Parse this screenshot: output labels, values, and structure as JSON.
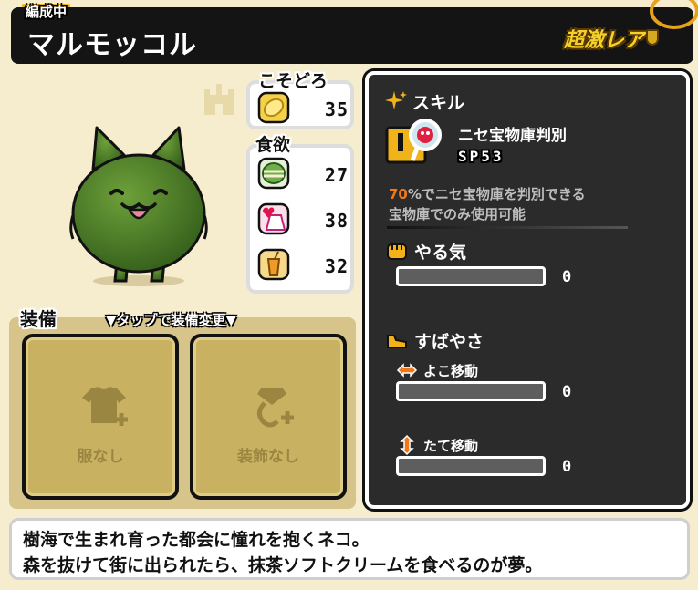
{
  "header": {
    "status_tag": "編成中",
    "name": "マルモッコル",
    "rarity": "超激レア"
  },
  "stats": {
    "sneak": {
      "title": "こそどろ",
      "value": "35",
      "icon": "gold-coin-icon"
    },
    "appetite": {
      "title": "食欲",
      "items": [
        {
          "icon": "matcha-cake-icon",
          "value": "27"
        },
        {
          "icon": "heart-dessert-icon",
          "value": "38"
        },
        {
          "icon": "drink-cup-icon",
          "value": "32"
        }
      ]
    }
  },
  "equip": {
    "title": "装備",
    "hint": "▼タップで装備変更▼",
    "slots": [
      {
        "label": "服なし",
        "icon": "shirt-plus-icon"
      },
      {
        "label": "装飾なし",
        "icon": "jewel-plus-icon"
      }
    ]
  },
  "skill": {
    "title": "スキル",
    "name": "ニセ宝物庫判別",
    "sp": "SP53",
    "desc_pct": "70",
    "desc_line1": "%でニセ宝物庫を判別できる",
    "desc_line2": "宝物庫でのみ使用可能"
  },
  "motivation": {
    "title": "やる気",
    "value": "0",
    "fill": 0
  },
  "speed": {
    "title": "すばやさ",
    "horizontal": {
      "label": "よこ移動",
      "value": "0",
      "fill": 0
    },
    "vertical": {
      "label": "たて移動",
      "value": "0",
      "fill": 0
    }
  },
  "description": {
    "line1": "樹海で生まれ育った都会に憧れを抱くネコ。",
    "line2": "森を抜けて街に出られたら、抹茶ソフトクリームを食べるのが夢。"
  },
  "colors": {
    "accent": "#f2b21a",
    "panel_dark": "#2b2b2b",
    "cat_green": "#4f7f2a",
    "pct_orange": "#f07a1a"
  }
}
